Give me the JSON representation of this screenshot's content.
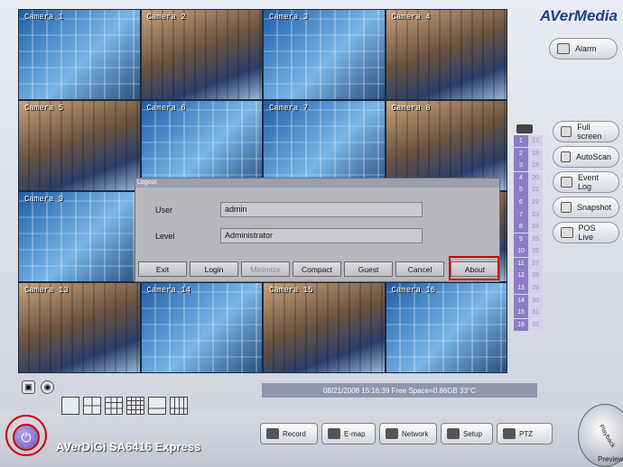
{
  "brand": {
    "logo_top": "AVerMedia",
    "product": "AVerDiGi SA6416 Express"
  },
  "cameras": [
    {
      "label": "Camera 1"
    },
    {
      "label": "Camera 2"
    },
    {
      "label": "Camera 3"
    },
    {
      "label": "Camera 4"
    },
    {
      "label": "Camera 5"
    },
    {
      "label": "Camera 6"
    },
    {
      "label": "Camera 7"
    },
    {
      "label": "Camera 8"
    },
    {
      "label": "Camera 9"
    },
    {
      "label": ""
    },
    {
      "label": ""
    },
    {
      "label": ""
    },
    {
      "label": "Camera 13"
    },
    {
      "label": "Camera 14"
    },
    {
      "label": "Camera 15"
    },
    {
      "label": "Camera 16"
    }
  ],
  "right_panel": {
    "alarm": "Alarm",
    "full_screen": "Full screen",
    "autoscan": "AutoScan",
    "event_log": "Event Log",
    "snapshot": "Snapshot",
    "pos_live": "POS Live"
  },
  "channels": {
    "left": [
      "1",
      "2",
      "3",
      "4",
      "5",
      "6",
      "7",
      "8",
      "9",
      "10",
      "11",
      "12",
      "13",
      "14",
      "15",
      "16"
    ],
    "right": [
      "17",
      "18",
      "19",
      "20",
      "21",
      "22",
      "23",
      "24",
      "25",
      "26",
      "27",
      "28",
      "29",
      "30",
      "31",
      "32"
    ]
  },
  "status_bar": "08/21/2008 15:16:39  Free Space=0.86GB 33°C",
  "dialog": {
    "title": "Logout",
    "user_label": "User",
    "user_value": "admin",
    "level_label": "Level",
    "level_value": "Administrator",
    "buttons": {
      "exit": "Exit",
      "login": "Login",
      "minimize": "Minimize",
      "compact": "Compact",
      "guest": "Guest",
      "cancel": "Cancel",
      "about": "About"
    }
  },
  "bottom": {
    "record": "Record",
    "emap": "E-map",
    "network": "Network",
    "setup": "Setup",
    "ptz": "PTZ",
    "playback": "Playback",
    "preview": "Preview"
  },
  "colors": {
    "highlight_red": "#d10000",
    "channel_active": "#8c7cc6",
    "brand_blue": "#1d3f8a"
  }
}
